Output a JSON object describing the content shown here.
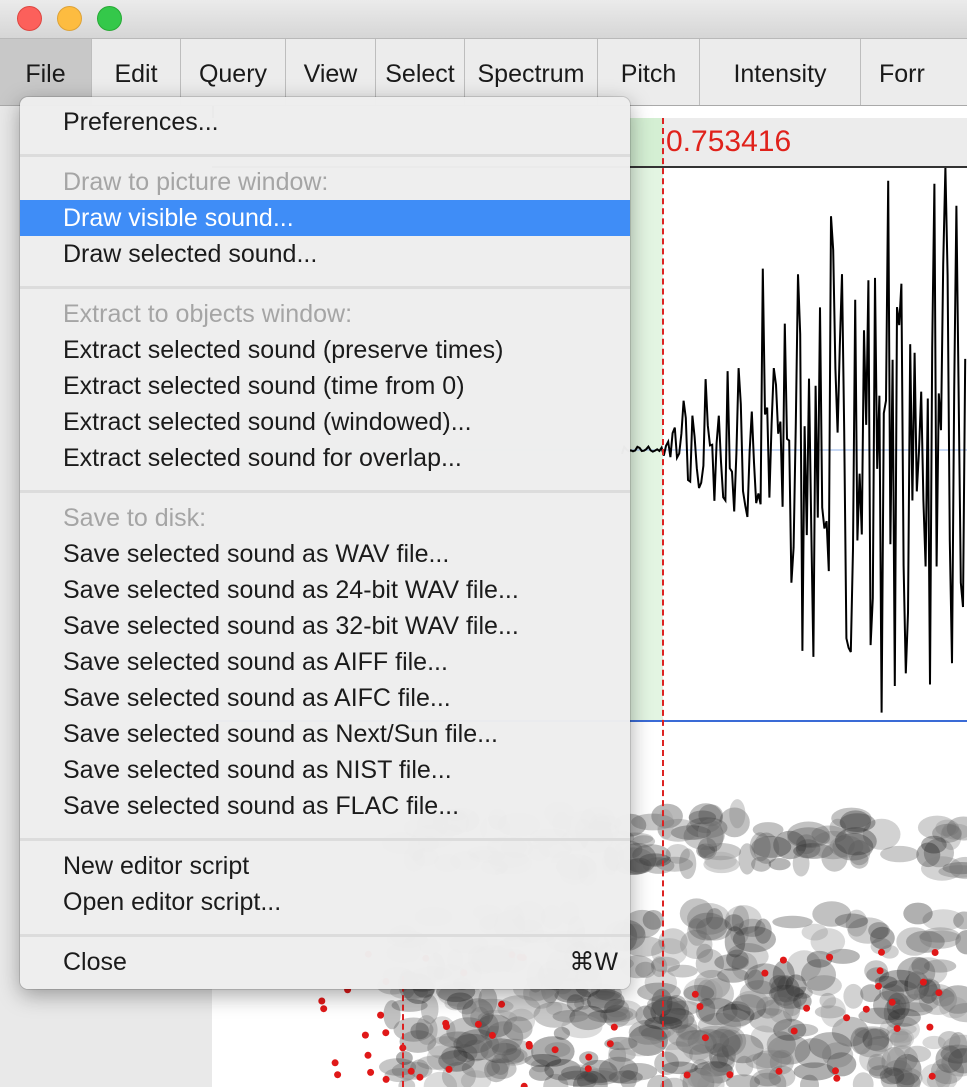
{
  "window": {
    "controls": [
      "close",
      "minimize",
      "zoom"
    ]
  },
  "menubar": [
    {
      "label": "File",
      "active": true
    },
    {
      "label": "Edit"
    },
    {
      "label": "Query"
    },
    {
      "label": "View"
    },
    {
      "label": "Select"
    },
    {
      "label": "Spectrum"
    },
    {
      "label": "Pitch"
    },
    {
      "label": "Intensity"
    },
    {
      "label": "Forr"
    }
  ],
  "editor": {
    "cursor_time": "0.753416"
  },
  "file_menu": {
    "items": [
      {
        "label": "Preferences...",
        "type": "item"
      },
      {
        "type": "separator"
      },
      {
        "label": "Draw to picture window:",
        "type": "header"
      },
      {
        "label": "Draw visible sound...",
        "type": "item",
        "highlighted": true
      },
      {
        "label": "Draw selected sound...",
        "type": "item"
      },
      {
        "type": "separator"
      },
      {
        "label": "Extract to objects window:",
        "type": "header"
      },
      {
        "label": "Extract selected sound (preserve times)",
        "type": "item"
      },
      {
        "label": "Extract selected sound (time from 0)",
        "type": "item"
      },
      {
        "label": "Extract selected sound (windowed)...",
        "type": "item"
      },
      {
        "label": "Extract selected sound for overlap...",
        "type": "item"
      },
      {
        "type": "separator"
      },
      {
        "label": "Save to disk:",
        "type": "header"
      },
      {
        "label": "Save selected sound as WAV file...",
        "type": "item"
      },
      {
        "label": "Save selected sound as 24-bit WAV file...",
        "type": "item"
      },
      {
        "label": "Save selected sound as 32-bit WAV file...",
        "type": "item"
      },
      {
        "label": "Save selected sound as AIFF file...",
        "type": "item"
      },
      {
        "label": "Save selected sound as AIFC file...",
        "type": "item"
      },
      {
        "label": "Save selected sound as Next/Sun file...",
        "type": "item"
      },
      {
        "label": "Save selected sound as NIST file...",
        "type": "item"
      },
      {
        "label": "Save selected sound as FLAC file...",
        "type": "item"
      },
      {
        "type": "separator"
      },
      {
        "label": "New editor script",
        "type": "item"
      },
      {
        "label": "Open editor script...",
        "type": "item"
      },
      {
        "type": "separator"
      },
      {
        "label": "Close",
        "type": "item",
        "shortcut": "⌘W"
      }
    ]
  },
  "colors": {
    "highlight": "#3f8df7",
    "cursor": "#e0221b",
    "selection": "#d4efd3"
  }
}
